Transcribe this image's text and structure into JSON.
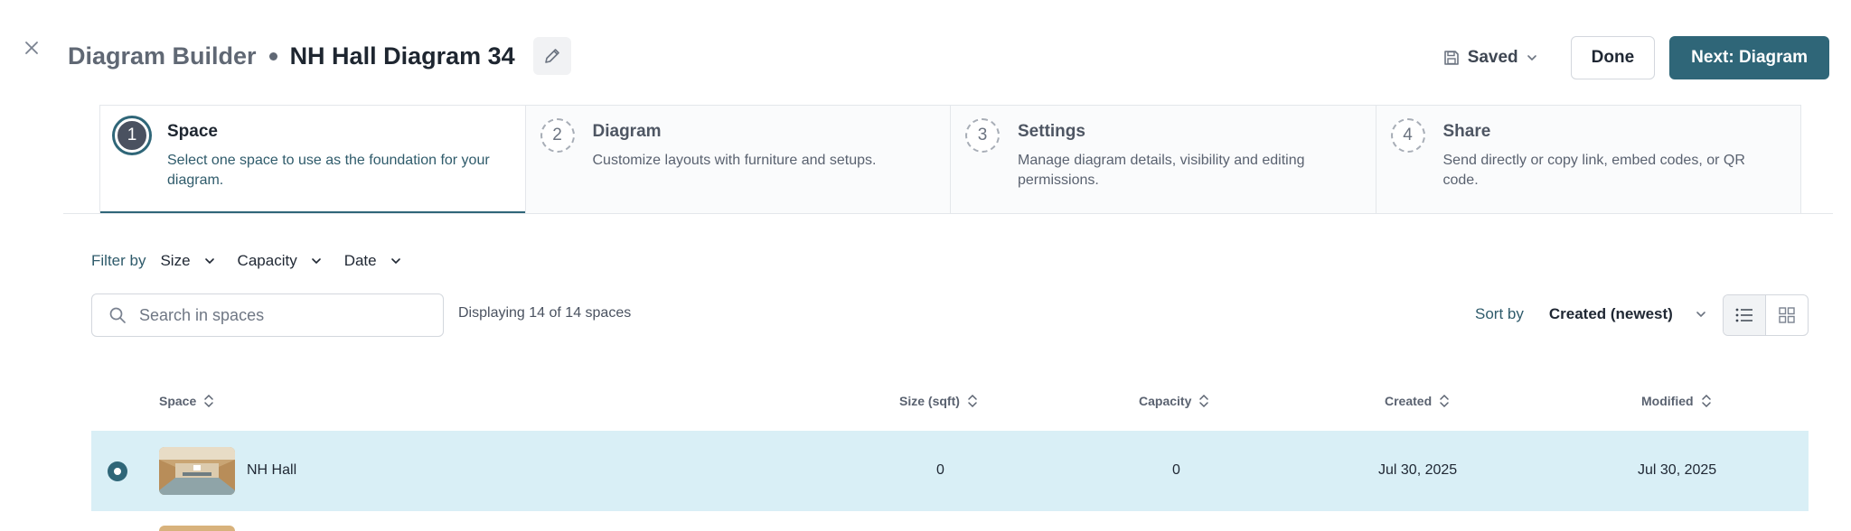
{
  "header": {
    "close_icon": "close-icon",
    "app_title": "Diagram Builder",
    "diagram_name": "NH Hall Diagram 34",
    "edit_icon": "pencil-icon",
    "saved_label": "Saved",
    "done_label": "Done",
    "next_label": "Next: Diagram"
  },
  "steps": [
    {
      "number": "1",
      "title": "Space",
      "desc_line1": "Select one space to use as the foundation for your",
      "desc_line2": "diagram.",
      "active": true
    },
    {
      "number": "2",
      "title": "Diagram",
      "desc_line1": "Customize layouts with furniture and setups.",
      "desc_line2": "",
      "active": false
    },
    {
      "number": "3",
      "title": "Settings",
      "desc_line1": "Manage diagram details, visibility and editing",
      "desc_line2": "permissions.",
      "active": false
    },
    {
      "number": "4",
      "title": "Share",
      "desc_line1": "Send directly or copy link, embed codes, or QR",
      "desc_line2": "code.",
      "active": false
    }
  ],
  "filters": {
    "label": "Filter by",
    "items": [
      "Size",
      "Capacity",
      "Date"
    ]
  },
  "search": {
    "placeholder": "Search in spaces",
    "value": ""
  },
  "displaying_text": "Displaying 14 of 14 spaces",
  "sort": {
    "label": "Sort by",
    "selected": "Created (newest)"
  },
  "view_modes": [
    "list-view-icon",
    "grid-view-icon"
  ],
  "table": {
    "columns": [
      "Space",
      "Size (sqft)",
      "Capacity",
      "Created",
      "Modified"
    ],
    "rows": [
      {
        "name": "NH Hall",
        "size": "0",
        "capacity": "0",
        "created": "Jul 30, 2025",
        "modified": "Jul 30, 2025",
        "selected": true
      }
    ]
  },
  "colors": {
    "primary": "#2f6678",
    "selected_row": "#d9eff6",
    "text_dark": "#1e2630"
  }
}
